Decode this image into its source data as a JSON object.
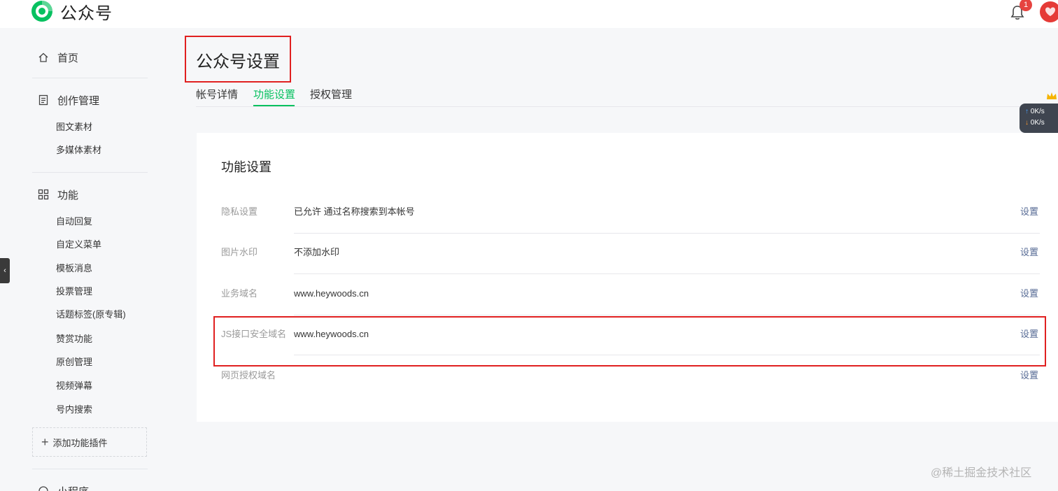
{
  "app": {
    "brand_name": "公众号",
    "notification_count": "1",
    "colors": {
      "accent": "#07c160",
      "link": "#576b95",
      "badge": "#e64340",
      "annotation": "#e02020"
    }
  },
  "sidebar": {
    "home": {
      "label": "首页",
      "icon": "home-icon"
    },
    "creation": {
      "label": "创作管理",
      "icon": "document-icon",
      "items": [
        {
          "label": "图文素材"
        },
        {
          "label": "多媒体素材"
        }
      ]
    },
    "features": {
      "label": "功能",
      "icon": "grid-icon",
      "items": [
        {
          "label": "自动回复"
        },
        {
          "label": "自定义菜单"
        },
        {
          "label": "模板消息"
        },
        {
          "label": "投票管理"
        },
        {
          "label": "话题标签(原专辑)"
        },
        {
          "label": "赞赏功能"
        },
        {
          "label": "原创管理"
        },
        {
          "label": "视频弹幕"
        },
        {
          "label": "号内搜索"
        }
      ]
    },
    "add_plugin_label": "添加功能插件",
    "mini_program": {
      "label": "小程序",
      "icon": "mini-program-icon"
    }
  },
  "main": {
    "page_title": "公众号设置",
    "tabs": [
      {
        "label": "帐号详情",
        "active": false
      },
      {
        "label": "功能设置",
        "active": true
      },
      {
        "label": "授权管理",
        "active": false
      }
    ],
    "card_title": "功能设置",
    "rows": [
      {
        "label": "隐私设置",
        "value": "已允许 通过名称搜索到本帐号",
        "action": "设置"
      },
      {
        "label": "图片水印",
        "value": "不添加水印",
        "action": "设置"
      },
      {
        "label": "业务域名",
        "value": "www.heywoods.cn",
        "action": "设置"
      },
      {
        "label": "JS接口安全域名",
        "value": "www.heywoods.cn",
        "action": "设置"
      },
      {
        "label": "网页授权域名",
        "value": "",
        "action": "设置"
      }
    ]
  },
  "speed_widget": {
    "up": "0K/s",
    "down": "0K/s"
  },
  "watermark": "@稀土掘金技术社区"
}
